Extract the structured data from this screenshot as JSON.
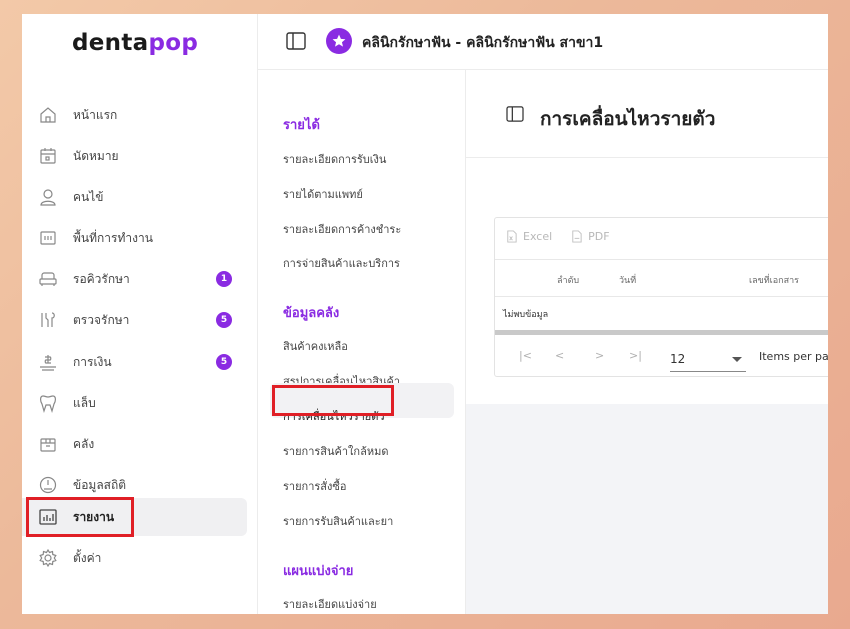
{
  "brand": {
    "logo_part1": "denta",
    "logo_part2": "pop"
  },
  "header": {
    "clinic_title": "คลินิกรักษาฟัน - คลินิกรักษาฟัน สาขา1"
  },
  "sidebar": {
    "items": [
      {
        "label": "หน้าแรก",
        "icon": "home-icon"
      },
      {
        "label": "นัดหมาย",
        "icon": "calendar-icon"
      },
      {
        "label": "คนไข้",
        "icon": "user-icon"
      },
      {
        "label": "พื้นที่การทำงาน",
        "icon": "workspace-icon"
      },
      {
        "label": "รอคิวรักษา",
        "icon": "sofa-icon",
        "badge": "1"
      },
      {
        "label": "ตรวจรักษา",
        "icon": "dental-tools-icon",
        "badge": "5"
      },
      {
        "label": "การเงิน",
        "icon": "money-icon",
        "badge": "5"
      },
      {
        "label": "แล็บ",
        "icon": "tooth-icon"
      },
      {
        "label": "คลัง",
        "icon": "box-icon"
      },
      {
        "label": "ข้อมูลสถิติ",
        "icon": "gauge-icon"
      },
      {
        "label": "รายงาน",
        "icon": "bar-chart-icon",
        "active": true
      },
      {
        "label": "ตั้งค่า",
        "icon": "settings-icon"
      }
    ]
  },
  "submenu": {
    "sections": [
      {
        "title": "รายได้",
        "items": [
          "รายละเอียดการรับเงิน",
          "รายได้ตามแพทย์",
          "รายละเอียดการค้างชำระ",
          "การจ่ายสินค้าและบริการ"
        ]
      },
      {
        "title": "ข้อมูลคลัง",
        "items": [
          "สินค้าคงเหลือ",
          "สรุปการเคลื่อนไหวสินค้า",
          "การเคลื่อนไหวรายตัว",
          "รายการสินค้าใกล้หมด",
          "รายการสั่งซื้อ",
          "รายการรับสินค้าและยา"
        ]
      },
      {
        "title": "แผนแบ่งจ่าย",
        "items": [
          "รายละเอียดแบ่งจ่าย"
        ]
      }
    ],
    "active_item": "การเคลื่อนไหวรายตัว"
  },
  "main": {
    "title": "การเคลื่อนไหวรายตัว",
    "export": {
      "excel": "Excel",
      "pdf": "PDF"
    },
    "table": {
      "columns": [
        "ลำดับ",
        "วันที่",
        "เลขที่เอกสาร"
      ],
      "empty_text": "ไม่พบข้อมูล"
    },
    "pagination": {
      "first": "|<",
      "prev": "<",
      "next": ">",
      "last": ">|",
      "per_page_value": "12",
      "per_page_label": "Items per pa"
    }
  },
  "colors": {
    "accent": "#8a2be2",
    "highlight": "#e01f26"
  }
}
